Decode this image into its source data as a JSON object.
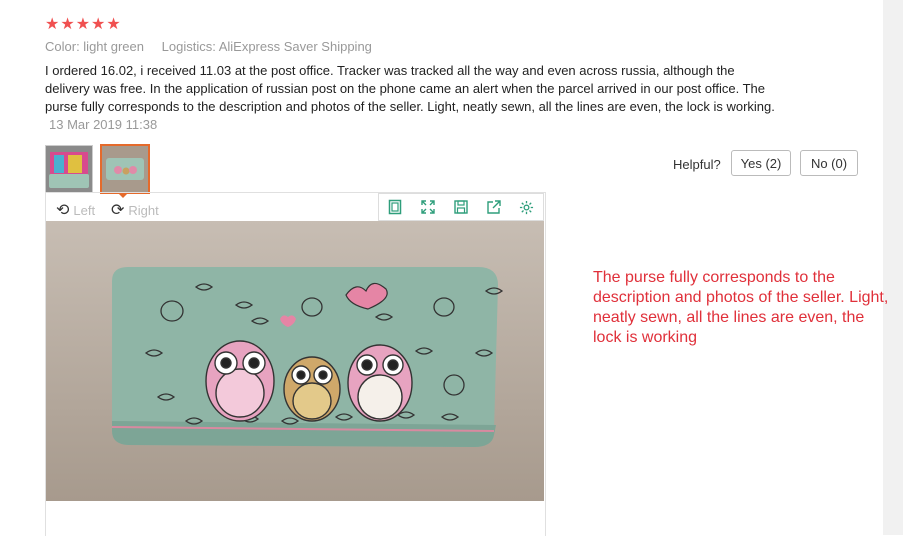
{
  "review": {
    "stars": "★★★★★",
    "color_label": "Color: light green",
    "logistics_label": "Logistics: AliExpress Saver Shipping",
    "text": "I ordered 16.02, i received 11.03 at the post office. Tracker was tracked all the way and even across russia, although the delivery was free. In the application of russian post on the phone came an alert when the parcel arrived in our post office. The purse fully corresponds to the description and photos of the seller. Light, neatly sewn, all the lines are even, the lock is working.",
    "date": "13 Mar 2019 11:38"
  },
  "helpful": {
    "label": "Helpful?",
    "yes_label": "Yes (2)",
    "no_label": "No (0)"
  },
  "viewer": {
    "rotate_left": "Left",
    "rotate_right": "Right",
    "toolbar_icons": [
      "fit-icon",
      "fullscreen-icon",
      "save-icon",
      "share-icon",
      "settings-icon"
    ]
  },
  "caption": "The purse fully corresponds to the description and photos of the seller. Light, neatly sewn, all the lines are even, the lock is working",
  "colors": {
    "accent": "#2e9e7b",
    "star": "#f05050",
    "caption": "#e0303a",
    "selected_border": "#e56a2b"
  }
}
